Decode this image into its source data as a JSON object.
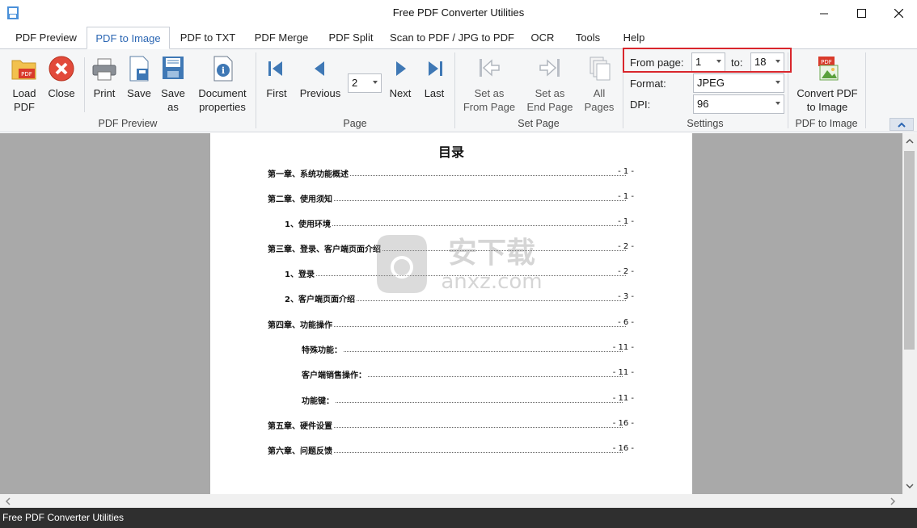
{
  "window": {
    "title": "Free PDF Converter Utilities"
  },
  "tabs": [
    {
      "label": "PDF Preview"
    },
    {
      "label": "PDF to Image"
    },
    {
      "label": "PDF to TXT"
    },
    {
      "label": "PDF Merge"
    },
    {
      "label": "PDF Split"
    },
    {
      "label": "Scan to PDF / JPG to PDF"
    },
    {
      "label": "OCR"
    },
    {
      "label": "Tools"
    },
    {
      "label": "Help"
    }
  ],
  "ribbon": {
    "preview_group": {
      "label": "PDF Preview",
      "load_l1": "Load",
      "load_l2": "PDF",
      "close": "Close",
      "print": "Print",
      "save": "Save",
      "saveas_l1": "Save",
      "saveas_l2": "as",
      "docprops_l1": "Document",
      "docprops_l2": "properties"
    },
    "page_group": {
      "label": "Page",
      "first": "First",
      "previous": "Previous",
      "page_value": "2",
      "next": "Next",
      "last": "Last"
    },
    "setpage_group": {
      "label": "Set Page",
      "from_l1": "Set as",
      "from_l2": "From Page",
      "end_l1": "Set as",
      "end_l2": "End Page",
      "all_l1": "All",
      "all_l2": "Pages"
    },
    "settings_group": {
      "label": "Settings",
      "from_label": "From page:",
      "from_value": "1",
      "to_label": "to:",
      "to_value": "18",
      "format_label": "Format:",
      "format_value": "JPEG",
      "dpi_label": "DPI:",
      "dpi_value": "96"
    },
    "convert_group": {
      "label": "PDF to Image",
      "convert_l1": "Convert PDF",
      "convert_l2": "to Image"
    }
  },
  "document": {
    "toc_title": "目录",
    "entries": [
      {
        "text": "第一章、系统功能概述",
        "page": "- 1 -"
      },
      {
        "text": "第二章、使用须知",
        "page": "- 1 -"
      },
      {
        "text": "1、使用环境",
        "page": "- 1 -"
      },
      {
        "text": "第三章、登录、客户端页面介绍",
        "page": "- 2 -"
      },
      {
        "text": "1、登录",
        "page": "- 2 -"
      },
      {
        "text": "2、客户端页面介绍",
        "page": "- 3 -"
      },
      {
        "text": "第四章、功能操作",
        "page": "- 6 -"
      },
      {
        "text": "特殊功能：",
        "page": "- 11 -"
      },
      {
        "text": "客户端销售操作：",
        "page": "- 11 -"
      },
      {
        "text": "功能键：",
        "page": "- 11 -"
      },
      {
        "text": "第五章、硬件设置",
        "page": "- 16 -"
      },
      {
        "text": "第六章、问题反馈",
        "page": "- 16 -"
      }
    ],
    "watermark_text": "anxz.com",
    "watermark_cn": "安下载"
  },
  "statusbar": {
    "text": "Free PDF Converter Utilities"
  },
  "colors": {
    "accent": "#2b66b3",
    "highlight_border": "#d9262c",
    "statusbar_bg": "#2f2f2f",
    "doc_bg": "#a9a9a9"
  }
}
